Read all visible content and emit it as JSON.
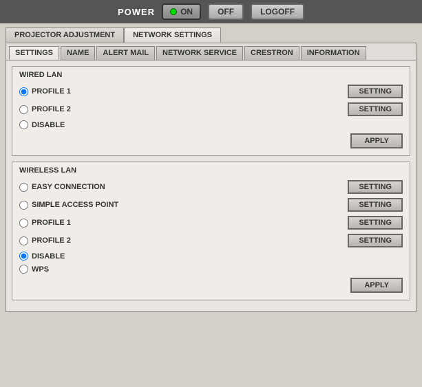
{
  "topbar": {
    "power_label": "POWER",
    "on_label": "ON",
    "off_label": "OFF",
    "logoff_label": "LOGOFF"
  },
  "outer_tabs": [
    {
      "id": "projector",
      "label": "PROJECTOR ADJUSTMENT",
      "active": false
    },
    {
      "id": "network",
      "label": "NETWORK SETTINGS",
      "active": true
    }
  ],
  "inner_tabs": [
    {
      "id": "settings",
      "label": "SETTINGS",
      "active": true
    },
    {
      "id": "name",
      "label": "NAME",
      "active": false
    },
    {
      "id": "alert_mail",
      "label": "ALERT MAIL",
      "active": false
    },
    {
      "id": "network_service",
      "label": "NETWORK SERVICE",
      "active": false
    },
    {
      "id": "crestron",
      "label": "CRESTRON",
      "active": false
    },
    {
      "id": "information",
      "label": "INFORMATION",
      "active": false
    }
  ],
  "wired_lan": {
    "title": "WIRED LAN",
    "options": [
      {
        "id": "w_profile1",
        "label": "PROFILE 1",
        "checked": true,
        "has_button": true
      },
      {
        "id": "w_profile2",
        "label": "PROFILE 2",
        "checked": false,
        "has_button": true
      },
      {
        "id": "w_disable",
        "label": "DISABLE",
        "checked": false,
        "has_button": false
      }
    ],
    "setting_label": "SETTING",
    "apply_label": "APPLY"
  },
  "wireless_lan": {
    "title": "WIRELESS LAN",
    "options": [
      {
        "id": "wl_easy",
        "label": "EASY CONNECTION",
        "checked": false,
        "has_button": true
      },
      {
        "id": "wl_simple",
        "label": "SIMPLE ACCESS POINT",
        "checked": false,
        "has_button": true
      },
      {
        "id": "wl_profile1",
        "label": "PROFILE 1",
        "checked": false,
        "has_button": true
      },
      {
        "id": "wl_profile2",
        "label": "PROFILE 2",
        "checked": false,
        "has_button": true
      },
      {
        "id": "wl_disable",
        "label": "DISABLE",
        "checked": true,
        "has_button": false
      },
      {
        "id": "wl_wps",
        "label": "WPS",
        "checked": false,
        "has_button": false
      }
    ],
    "setting_label": "SETTING",
    "apply_label": "APPLY"
  }
}
